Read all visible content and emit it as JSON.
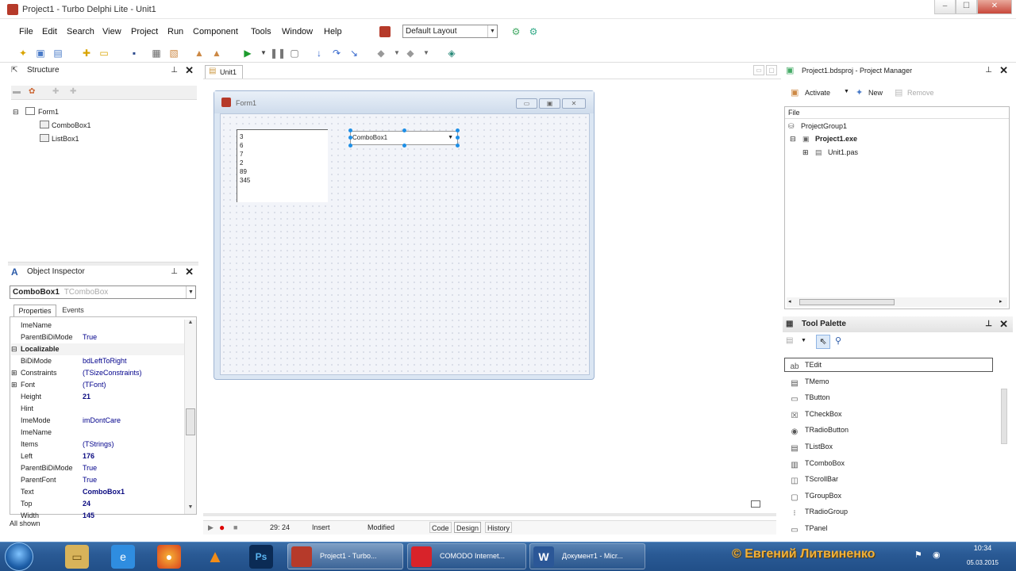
{
  "window": {
    "title": "Project1 - Turbo Delphi Lite - Unit1",
    "controls": [
      "–",
      "☐",
      "✕"
    ]
  },
  "menu": {
    "items": [
      "File",
      "Edit",
      "Search",
      "View",
      "Project",
      "Run",
      "Component",
      "Tools",
      "Window",
      "Help"
    ],
    "layout_combo": "Default Layout"
  },
  "structure": {
    "title": "Structure",
    "items": [
      "Form1",
      "ComboBox1",
      "ListBox1"
    ]
  },
  "object_inspector": {
    "title": "Object Inspector",
    "selected_object": "ComboBox1",
    "selected_class": "TComboBox",
    "tabs": [
      "Properties",
      "Events"
    ],
    "rows": [
      {
        "name": "ImeName",
        "value": ""
      },
      {
        "name": "ParentBiDiMode",
        "value": "True"
      },
      {
        "name": "Localizable",
        "value": "",
        "category": true
      },
      {
        "name": "BiDiMode",
        "value": "bdLeftToRight"
      },
      {
        "name": "Constraints",
        "value": "(TSizeConstraints)",
        "expand": "⊞"
      },
      {
        "name": "Font",
        "value": "(TFont)",
        "expand": "⊞"
      },
      {
        "name": "Height",
        "value": "21",
        "bold": true
      },
      {
        "name": "Hint",
        "value": ""
      },
      {
        "name": "ImeMode",
        "value": "imDontCare"
      },
      {
        "name": "ImeName",
        "value": ""
      },
      {
        "name": "Items",
        "value": "(TStrings)"
      },
      {
        "name": "Left",
        "value": "176",
        "bold": true
      },
      {
        "name": "ParentBiDiMode",
        "value": "True"
      },
      {
        "name": "ParentFont",
        "value": "True"
      },
      {
        "name": "Text",
        "value": "ComboBox1",
        "bold": true
      },
      {
        "name": "Top",
        "value": "24",
        "bold": true
      },
      {
        "name": "Width",
        "value": "145",
        "bold": true
      }
    ],
    "status": "All shown"
  },
  "designer": {
    "tab": "Unit1",
    "form_title": "Form1",
    "listbox_items": [
      "3",
      "6",
      "7",
      "2",
      "89",
      "345"
    ],
    "combobox_text": "ComboBox1",
    "status": {
      "position": "29:  24",
      "mode": "Insert",
      "modified": "Modified",
      "tabs": [
        "Code",
        "Design",
        "History"
      ]
    }
  },
  "project_manager": {
    "title": "Project1.bdsproj - Project Manager",
    "actions": [
      "Activate",
      "New",
      "Remove"
    ],
    "column": "File",
    "group": "ProjectGroup1",
    "project": "Project1.exe",
    "unit": "Unit1.pas"
  },
  "tool_palette": {
    "title": "Tool Palette",
    "items": [
      {
        "label": "TEdit",
        "icon": "ab"
      },
      {
        "label": "TMemo",
        "icon": "▤"
      },
      {
        "label": "TButton",
        "icon": "▭"
      },
      {
        "label": "TCheckBox",
        "icon": "☒"
      },
      {
        "label": "TRadioButton",
        "icon": "◉"
      },
      {
        "label": "TListBox",
        "icon": "▤"
      },
      {
        "label": "TComboBox",
        "icon": "▥"
      },
      {
        "label": "TScrollBar",
        "icon": "◫"
      },
      {
        "label": "TGroupBox",
        "icon": "▢"
      },
      {
        "label": "TRadioGroup",
        "icon": "⁝"
      },
      {
        "label": "TPanel",
        "icon": "▭"
      }
    ]
  },
  "taskbar": {
    "tasks": [
      "Project1 - Turbo...",
      "COMODO Internet...",
      "Документ1 - Micr..."
    ],
    "tray_text": "© Евгений Литвиненко",
    "time": "10:34",
    "date": "05.03.2015"
  },
  "colors": {
    "accent": "#1e8fe6",
    "taskbar": "#2a5a95",
    "category": "#c0002a"
  }
}
